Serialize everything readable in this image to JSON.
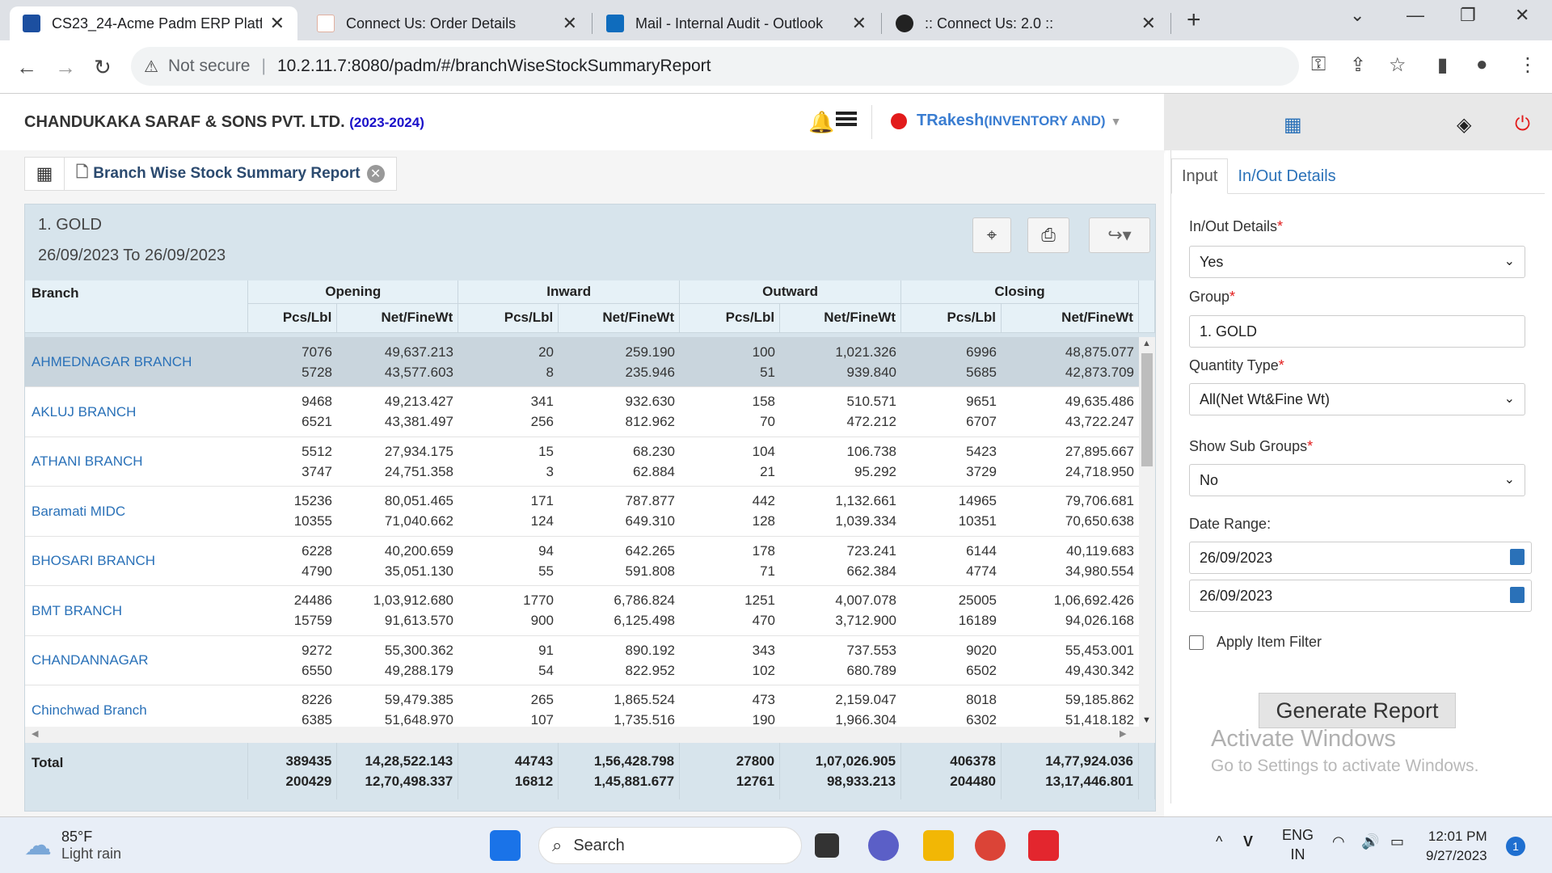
{
  "browser": {
    "tabs": [
      {
        "title": "CS23_24-Acme Padm ERP Platfo",
        "close": "✕"
      },
      {
        "title": "Connect Us: Order Details",
        "close": "✕"
      },
      {
        "title": "Mail - Internal Audit - Outlook",
        "close": "✕"
      },
      {
        "title": ":: Connect Us: 2.0 ::",
        "close": "✕"
      }
    ],
    "new_tab": "+",
    "security_label": "Not secure",
    "url": "10.2.11.7:8080/padm/#/branchWiseStockSummaryReport"
  },
  "header": {
    "company": "CHANDUKAKA SARAF & SONS PVT. LTD.",
    "year": "(2023-2024)",
    "user_name": "TRakesh",
    "user_role": "(INVENTORY AND)"
  },
  "report_tab": {
    "label": "Branch Wise Stock Summary Report",
    "close": "✕"
  },
  "report": {
    "group_title": "1. GOLD",
    "date_range": "26/09/2023 To 26/09/2023",
    "columns": {
      "branch": "Branch",
      "groups": [
        "Opening",
        "Inward",
        "Outward",
        "Closing"
      ],
      "sub": [
        "Pcs/Lbl",
        "Net/FineWt"
      ]
    },
    "rows": [
      {
        "branch": "AHMEDNAGAR BRANCH",
        "op_pcs": "7076",
        "op_pcs2": "5728",
        "op_wt": "49,637.213",
        "op_wt2": "43,577.603",
        "in_pcs": "20",
        "in_pcs2": "8",
        "in_wt": "259.190",
        "in_wt2": "235.946",
        "out_pcs": "100",
        "out_pcs2": "51",
        "out_wt": "1,021.326",
        "out_wt2": "939.840",
        "cl_pcs": "6996",
        "cl_pcs2": "5685",
        "cl_wt": "48,875.077",
        "cl_wt2": "42,873.709"
      },
      {
        "branch": "AKLUJ BRANCH",
        "op_pcs": "9468",
        "op_pcs2": "6521",
        "op_wt": "49,213.427",
        "op_wt2": "43,381.497",
        "in_pcs": "341",
        "in_pcs2": "256",
        "in_wt": "932.630",
        "in_wt2": "812.962",
        "out_pcs": "158",
        "out_pcs2": "70",
        "out_wt": "510.571",
        "out_wt2": "472.212",
        "cl_pcs": "9651",
        "cl_pcs2": "6707",
        "cl_wt": "49,635.486",
        "cl_wt2": "43,722.247"
      },
      {
        "branch": "ATHANI BRANCH",
        "op_pcs": "5512",
        "op_pcs2": "3747",
        "op_wt": "27,934.175",
        "op_wt2": "24,751.358",
        "in_pcs": "15",
        "in_pcs2": "3",
        "in_wt": "68.230",
        "in_wt2": "62.884",
        "out_pcs": "104",
        "out_pcs2": "21",
        "out_wt": "106.738",
        "out_wt2": "95.292",
        "cl_pcs": "5423",
        "cl_pcs2": "3729",
        "cl_wt": "27,895.667",
        "cl_wt2": "24,718.950"
      },
      {
        "branch": "Baramati MIDC",
        "op_pcs": "15236",
        "op_pcs2": "10355",
        "op_wt": "80,051.465",
        "op_wt2": "71,040.662",
        "in_pcs": "171",
        "in_pcs2": "124",
        "in_wt": "787.877",
        "in_wt2": "649.310",
        "out_pcs": "442",
        "out_pcs2": "128",
        "out_wt": "1,132.661",
        "out_wt2": "1,039.334",
        "cl_pcs": "14965",
        "cl_pcs2": "10351",
        "cl_wt": "79,706.681",
        "cl_wt2": "70,650.638"
      },
      {
        "branch": "BHOSARI BRANCH",
        "op_pcs": "6228",
        "op_pcs2": "4790",
        "op_wt": "40,200.659",
        "op_wt2": "35,051.130",
        "in_pcs": "94",
        "in_pcs2": "55",
        "in_wt": "642.265",
        "in_wt2": "591.808",
        "out_pcs": "178",
        "out_pcs2": "71",
        "out_wt": "723.241",
        "out_wt2": "662.384",
        "cl_pcs": "6144",
        "cl_pcs2": "4774",
        "cl_wt": "40,119.683",
        "cl_wt2": "34,980.554"
      },
      {
        "branch": "BMT BRANCH",
        "op_pcs": "24486",
        "op_pcs2": "15759",
        "op_wt": "1,03,912.680",
        "op_wt2": "91,613.570",
        "in_pcs": "1770",
        "in_pcs2": "900",
        "in_wt": "6,786.824",
        "in_wt2": "6,125.498",
        "out_pcs": "1251",
        "out_pcs2": "470",
        "out_wt": "4,007.078",
        "out_wt2": "3,712.900",
        "cl_pcs": "25005",
        "cl_pcs2": "16189",
        "cl_wt": "1,06,692.426",
        "cl_wt2": "94,026.168"
      },
      {
        "branch": "CHANDANNAGAR",
        "op_pcs": "9272",
        "op_pcs2": "6550",
        "op_wt": "55,300.362",
        "op_wt2": "49,288.179",
        "in_pcs": "91",
        "in_pcs2": "54",
        "in_wt": "890.192",
        "in_wt2": "822.952",
        "out_pcs": "343",
        "out_pcs2": "102",
        "out_wt": "737.553",
        "out_wt2": "680.789",
        "cl_pcs": "9020",
        "cl_pcs2": "6502",
        "cl_wt": "55,453.001",
        "cl_wt2": "49,430.342"
      },
      {
        "branch": "Chinchwad Branch",
        "op_pcs": "8226",
        "op_pcs2": "6385",
        "op_wt": "59,479.385",
        "op_wt2": "51,648.970",
        "in_pcs": "265",
        "in_pcs2": "107",
        "in_wt": "1,865.524",
        "in_wt2": "1,735.516",
        "out_pcs": "473",
        "out_pcs2": "190",
        "out_wt": "2,159.047",
        "out_wt2": "1,966.304",
        "cl_pcs": "8018",
        "cl_pcs2": "6302",
        "cl_wt": "59,185.862",
        "cl_wt2": "51,418.182"
      }
    ],
    "total": {
      "label": "Total",
      "op_pcs": "389435",
      "op_pcs2": "200429",
      "op_wt": "14,28,522.143",
      "op_wt2": "12,70,498.337",
      "in_pcs": "44743",
      "in_pcs2": "16812",
      "in_wt": "1,56,428.798",
      "in_wt2": "1,45,881.677",
      "out_pcs": "27800",
      "out_pcs2": "12761",
      "out_wt": "1,07,026.905",
      "out_wt2": "98,933.213",
      "cl_pcs": "406378",
      "cl_pcs2": "204480",
      "cl_wt": "14,77,924.036",
      "cl_wt2": "13,17,446.801"
    }
  },
  "side_panel": {
    "tabs": [
      "Input",
      "In/Out Details"
    ],
    "inout_label": "In/Out Details",
    "inout_value": "Yes",
    "group_label": "Group",
    "group_value": "1. GOLD",
    "qty_label": "Quantity Type",
    "qty_value": "All(Net Wt&Fine Wt)",
    "subgroups_label": "Show Sub Groups",
    "subgroups_value": "No",
    "date_label": "Date Range:",
    "date_from": "26/09/2023",
    "date_to": "26/09/2023",
    "apply_filter_label": "Apply Item Filter",
    "generate_label": "Generate Report",
    "required_mark": "*"
  },
  "watermark": {
    "line1": "Activate Windows",
    "line2": "Go to Settings to activate Windows."
  },
  "taskbar": {
    "temp": "85°F",
    "weather": "Light rain",
    "search_placeholder": "Search",
    "lang1": "ENG",
    "lang2": "IN",
    "time": "12:01 PM",
    "date": "9/27/2023",
    "notif_count": "1"
  }
}
